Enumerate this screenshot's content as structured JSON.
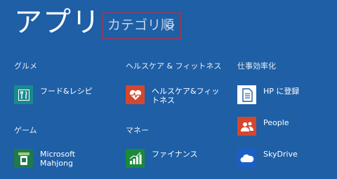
{
  "header": {
    "title": "アプリ",
    "sort_label": "カテゴリ順"
  },
  "groups": [
    {
      "name": "グルメ",
      "apps": [
        {
          "label": "フード&レシピ",
          "icon": "fork-knife-icon",
          "color": "#1a8a8d"
        }
      ]
    },
    {
      "name": "ゲーム",
      "apps": [
        {
          "label": "Microsoft Mahjong",
          "icon": "mahjong-tile-icon",
          "color": "#1f7a4c"
        }
      ]
    },
    {
      "name": "ヘルスケア & フィットネス",
      "apps": [
        {
          "label": "ヘルスケア&フィットネス",
          "icon": "heart-pulse-icon",
          "color": "#d4472f"
        }
      ]
    },
    {
      "name": "マネー",
      "apps": [
        {
          "label": "ファイナンス",
          "icon": "bar-chart-icon",
          "color": "#1b8a3a"
        }
      ]
    },
    {
      "name": "仕事効率化",
      "apps": [
        {
          "label": "HP に登録",
          "icon": "document-icon",
          "color": "#ffffff"
        },
        {
          "label": "People",
          "icon": "people-icon",
          "color": "#d4472f"
        },
        {
          "label": "SkyDrive",
          "icon": "cloud-icon",
          "color": "#1b5fc4"
        }
      ]
    }
  ],
  "colors": {
    "background": "#1e5fa6",
    "highlight_border": "#d9262b"
  }
}
